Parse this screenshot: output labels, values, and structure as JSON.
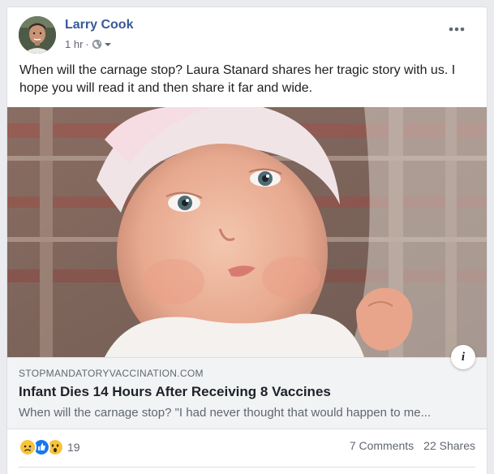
{
  "post": {
    "author": "Larry Cook",
    "time": "1 hr",
    "separator": "·",
    "text": "When will the carnage stop? Laura Stanard shares her tragic story with us. I hope you will read it and then share it far and wide."
  },
  "link": {
    "domain": "STOPMANDATORYVACCINATION.COM",
    "title": "Infant Dies 14 Hours After Receiving 8 Vaccines",
    "description": "When will the carnage stop? \"I had never thought that would happen to me...",
    "info_label": "i"
  },
  "footer": {
    "reaction_count": "19",
    "comments": "7 Comments",
    "shares": "22 Shares"
  },
  "icons": {
    "privacy": "globe-icon",
    "privacy_menu": "chevron-down-icon",
    "more": "more-options-icon",
    "reactions": [
      "sad-reaction-icon",
      "like-reaction-icon",
      "wow-reaction-icon"
    ]
  },
  "colors": {
    "author_link": "#385898",
    "text": "#1c1e21",
    "secondary": "#606770",
    "link_box_bg": "#f2f3f5",
    "like_blue": "#1877f2",
    "reaction_yellow": "#f7c33a"
  }
}
